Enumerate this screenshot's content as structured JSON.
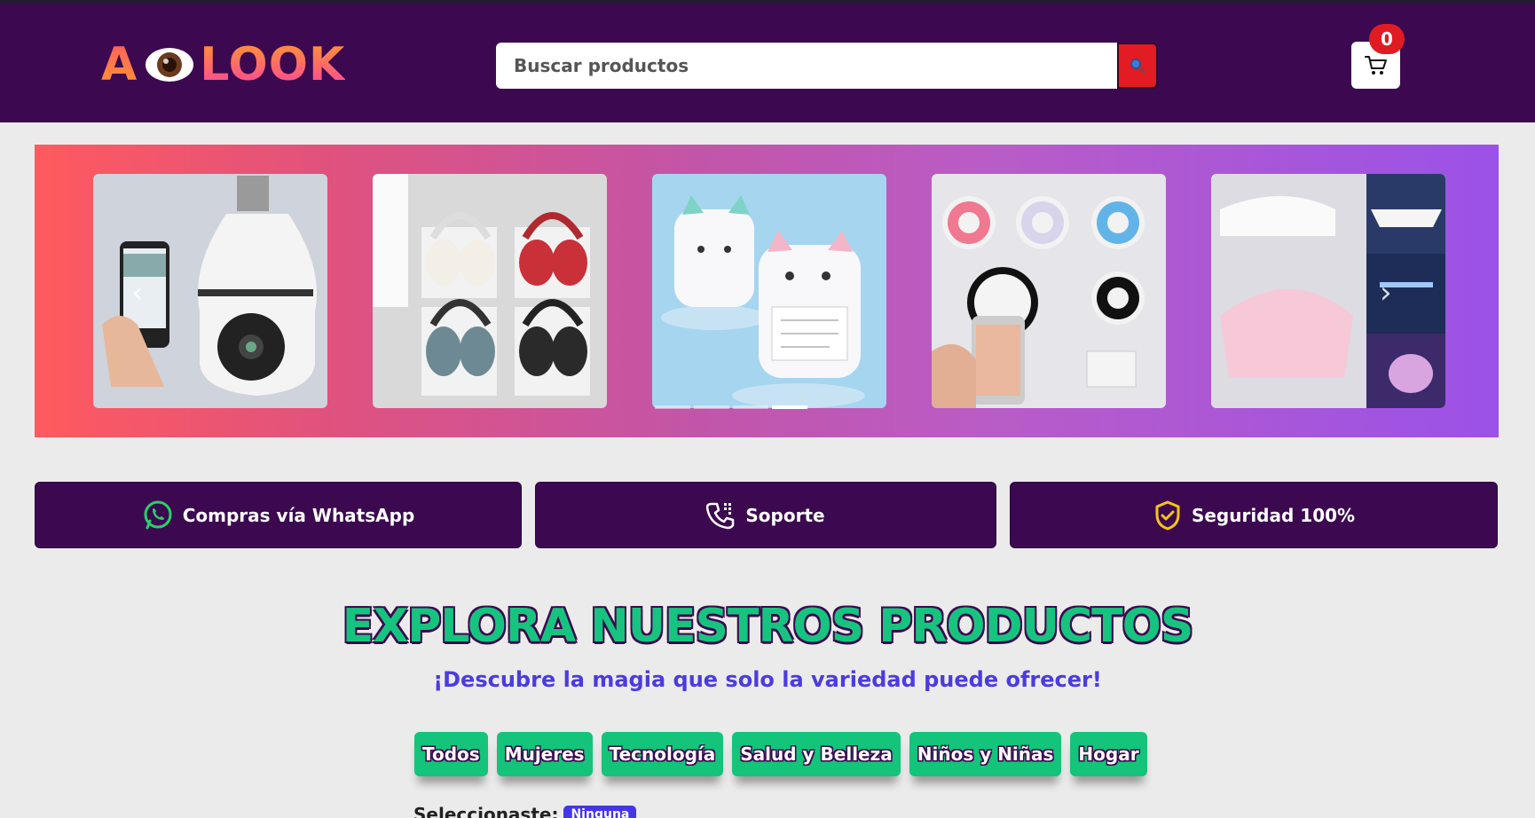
{
  "header": {
    "logo_left": "A",
    "logo_right": "LOOK",
    "search_placeholder": "Buscar productos",
    "cart_count": "0"
  },
  "features": [
    {
      "label": "Compras vía WhatsApp",
      "icon": "whatsapp-icon"
    },
    {
      "label": "Soporte",
      "icon": "phone-support-icon"
    },
    {
      "label": "Seguridad 100%",
      "icon": "shield-check-icon"
    }
  ],
  "main": {
    "title": "EXPLORA NUESTROS PRODUCTOS",
    "subtitle": "¡Descubre la magia que solo la variedad puede ofrecer!",
    "categories": [
      "Todos",
      "Mujeres",
      "Tecnología",
      "Salud y Belleza",
      "Niños y Niñas",
      "Hogar"
    ],
    "selected_label": "Seleccionaste:",
    "selected_value": "Ninguna"
  },
  "colors": {
    "header_bg": "#3c0950",
    "accent_green": "#13c47a",
    "accent_red": "#e31b23",
    "subtitle_blue": "#4b3be0"
  }
}
